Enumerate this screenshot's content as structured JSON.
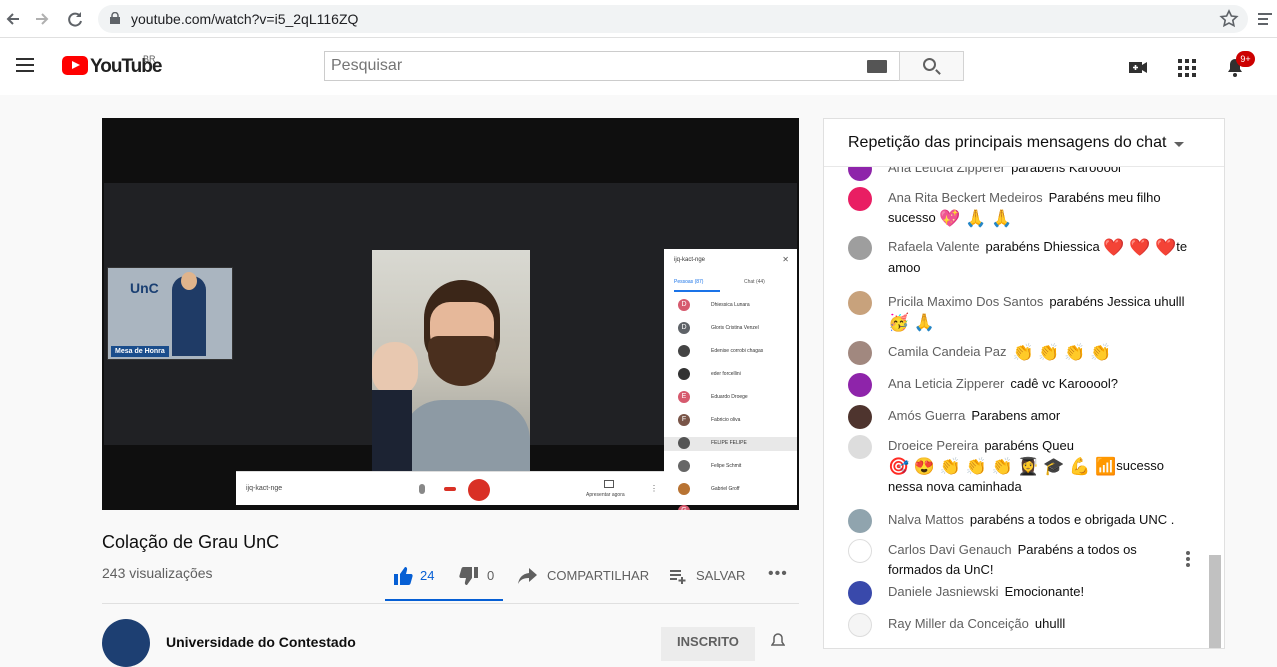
{
  "browser": {
    "url": "youtube.com/watch?v=i5_2qL116ZQ"
  },
  "header": {
    "logo": "YouTube",
    "country": "BR",
    "search_placeholder": "Pesquisar",
    "notification_count": "9+"
  },
  "video": {
    "pip_label": "Mesa de Honra",
    "pip_logo_text": "UnC",
    "meet_code": "ijq-kact-nge",
    "present_label": "Apresentar agora",
    "panel_title": "ijq-kact-nge",
    "panel_tab_people": "Pessoas (87)",
    "panel_tab_chat": "Chat (44)",
    "participants": [
      {
        "initial": "D",
        "name": "Dhiessica Lunara",
        "color": "#d65a6e"
      },
      {
        "initial": "D",
        "name": "Gloris Cristina Venzel",
        "color": "#5f6368"
      },
      {
        "initial": "",
        "name": "Edenise corrobi chagas",
        "color": "#444"
      },
      {
        "initial": "",
        "name": "eder forcellini",
        "color": "#333"
      },
      {
        "initial": "E",
        "name": "Eduardo Droege",
        "color": "#d65a6e"
      },
      {
        "initial": "F",
        "name": "Fabricio oliva",
        "color": "#795548"
      },
      {
        "initial": "",
        "name": "FELIPE FELIPE",
        "color": "#555"
      },
      {
        "initial": "",
        "name": "Felipe Schmit",
        "color": "#666"
      },
      {
        "initial": "",
        "name": "Gabriel Groff",
        "color": "#b87333"
      },
      {
        "initial": "G",
        "name": "",
        "color": "#d65a6e"
      }
    ]
  },
  "below": {
    "title": "Colação de Grau UnC",
    "views": "243 visualizações",
    "likes": "24",
    "dislikes": "0",
    "share": "COMPARTILHAR",
    "save": "SALVAR",
    "channel": "Universidade do Contestado",
    "subscribe": "INSCRITO"
  },
  "chat": {
    "title": "Repetição das principais mensagens do chat",
    "messages": [
      {
        "author": "Ana Letícia Zipperer",
        "text": "parabéns Karooool",
        "emoji": "",
        "text2": "",
        "avatar_color": "#8e24aa"
      },
      {
        "author": "Ana Rita Beckert Medeiros",
        "text": "Parabéns meu filho sucesso",
        "emoji": "💖 🙏 🙏",
        "text2": "",
        "avatar_color": "#e91e63"
      },
      {
        "author": "Rafaela Valente",
        "text": "parabéns Dhiessica",
        "emoji": "❤️ ❤️ ❤️",
        "text2": "te amoo",
        "avatar_color": "#9e9e9e"
      },
      {
        "author": "Pricila Maximo Dos Santos",
        "text": "parabéns Jessica uhulll",
        "emoji": "🥳 🙏",
        "text2": "",
        "avatar_color": "#c8a27c"
      },
      {
        "author": "Camila Candeia Paz",
        "text": "",
        "emoji": "👏 👏 👏 👏",
        "text2": "",
        "avatar_color": "#a1887f"
      },
      {
        "author": "Ana Leticia Zipperer",
        "text": "cadê vc Karooool?",
        "emoji": "",
        "text2": "",
        "avatar_color": "#8e24aa"
      },
      {
        "author": "Amós Guerra",
        "text": "Parabens amor",
        "emoji": "",
        "text2": "",
        "avatar_color": "#4e342e"
      },
      {
        "author": "Droeice Pereira",
        "text": "parabéns Queu",
        "emoji": "🎯 😍 👏 👏 👏 👩‍🎓 🎓 💪 📶",
        "text2": "sucesso nessa nova caminhada",
        "avatar_color": "#ddd"
      },
      {
        "author": "Nalva Mattos",
        "text": "parabéns a todos e obrigada UNC .",
        "emoji": "",
        "text2": "",
        "avatar_color": "#90a4ae"
      },
      {
        "author": "Carlos Davi Genauch",
        "text": "Parabéns a todos os formados da UnC!",
        "emoji": "",
        "text2": "",
        "avatar_color": "#fff"
      },
      {
        "author": "Daniele Jasniewski",
        "text": "Emocionante!",
        "emoji": "",
        "text2": "",
        "avatar_color": "#3949ab"
      },
      {
        "author": "Ray Miller da Conceição",
        "text": "uhulll",
        "emoji": "",
        "text2": "",
        "avatar_color": "#f5f5f5"
      }
    ]
  },
  "colors": {
    "accent_blue": "#065fd4",
    "youtube_red": "#ff0000",
    "badge_red": "#cc0000"
  }
}
